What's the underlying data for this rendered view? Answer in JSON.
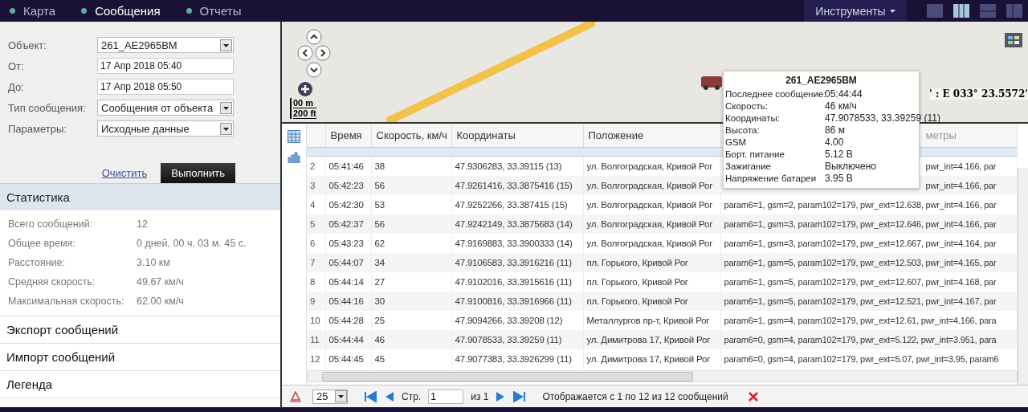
{
  "nav": {
    "tabs": [
      {
        "label": "Карта",
        "selected": false
      },
      {
        "label": "Сообщения",
        "selected": true
      },
      {
        "label": "Отчеты",
        "selected": false
      }
    ],
    "tools_menu": "Инструменты",
    "layouts": [
      {
        "selected": false
      },
      {
        "selected": true
      },
      {
        "selected": false
      },
      {
        "selected": false
      }
    ]
  },
  "form": {
    "fields": [
      {
        "label": "Объект:",
        "kind": "select",
        "value": "261_AE2965BM"
      },
      {
        "label": "От:",
        "kind": "input",
        "value": "17 Апр 2018 05:40"
      },
      {
        "label": "До:",
        "kind": "input",
        "value": "17 Апр 2018 05:50"
      },
      {
        "label": "Тип сообщения:",
        "kind": "select",
        "value": "Сообщения от объекта"
      },
      {
        "label": "Параметры:",
        "kind": "select",
        "value": "Исходные данные"
      }
    ],
    "clear_link": "Очистить",
    "run_button": "Выполнить"
  },
  "statistics": {
    "title": "Статистика",
    "rows": [
      {
        "label": "Всего сообщений:",
        "value": "12"
      },
      {
        "label": "Общее время:",
        "value": "0 дней, 00 ч. 03 м. 45 с."
      },
      {
        "label": "Расстояние:",
        "value": "3.10 км"
      },
      {
        "label": "Средняя скорость:",
        "value": "49.67 км/ч"
      },
      {
        "label": "Максимальная скорость:",
        "value": "62.00 км/ч"
      }
    ]
  },
  "sections": [
    "Экспорт сообщений",
    "Импорт сообщений",
    "Легенда"
  ],
  "map": {
    "scale": [
      "00 m",
      "200 ft"
    ],
    "coords_readout": "' : E 033° 23.5572'",
    "tooltip": {
      "title": "261_AE2965BM",
      "rows": [
        {
          "label": "Последнее сообщение:",
          "value": "05:44:44"
        },
        {
          "label": "Скорость:",
          "value": "46 км/ч"
        },
        {
          "label": "Координаты:",
          "value": "47.9078533, 33.39259 (11)"
        },
        {
          "label": "Высота:",
          "value": "86 м"
        },
        {
          "label": "GSM",
          "value": "4.00"
        },
        {
          "label": "Борт. питание",
          "value": "5.12 В"
        },
        {
          "label": "Зажигание",
          "value": "Выключено"
        },
        {
          "label": "Напряжение батареи",
          "value": "3.95 В"
        }
      ]
    }
  },
  "table": {
    "columns": [
      "Время",
      "Скорость, км/ч",
      "Координаты",
      "Положение",
      "метры"
    ],
    "rows": [
      {
        "n": "2",
        "time": "05:41:46",
        "speed": "38",
        "coords": "47.9306283, 33.39115 (13)",
        "place": "ул. Волгоградская, Кривой Рог",
        "params": "pwr_int=4.166, par",
        "covered": true
      },
      {
        "n": "3",
        "time": "05:42:23",
        "speed": "56",
        "coords": "47.9261416, 33.3875416 (15)",
        "place": "ул. Волгоградская, Кривой Рог",
        "params": "pwr_int=4.166, par",
        "covered": true
      },
      {
        "n": "4",
        "time": "05:42:30",
        "speed": "53",
        "coords": "47.9252266, 33.387415 (15)",
        "place": "ул. Волгоградская, Кривой Рог",
        "params": "param6=1, gsm=2, param102=179, pwr_ext=12.638, pwr_int=4.166, par",
        "covered": false
      },
      {
        "n": "5",
        "time": "05:42:37",
        "speed": "56",
        "coords": "47.9242149, 33.3875683 (14)",
        "place": "ул. Волгоградская, Кривой Рог",
        "params": "param6=1, gsm=3, param102=179, pwr_ext=12.646, pwr_int=4.166, par",
        "covered": false
      },
      {
        "n": "6",
        "time": "05:43:23",
        "speed": "62",
        "coords": "47.9169883, 33.3900333 (14)",
        "place": "ул. Волгоградская, Кривой Рог",
        "params": "param6=1, gsm=3, param102=179, pwr_ext=12.667, pwr_int=4.164, par",
        "covered": false
      },
      {
        "n": "7",
        "time": "05:44:07",
        "speed": "34",
        "coords": "47.9106583, 33.3916216 (11)",
        "place": "пл. Горького, Кривой Рог",
        "params": "param6=1, gsm=5, param102=179, pwr_ext=12.503, pwr_int=4.165, par",
        "covered": false
      },
      {
        "n": "8",
        "time": "05:44:14",
        "speed": "27",
        "coords": "47.9102016, 33.3915616 (11)",
        "place": "пл. Горького, Кривой Рог",
        "params": "param6=1, gsm=5, param102=179, pwr_ext=12.607, pwr_int=4.168, par",
        "covered": false
      },
      {
        "n": "9",
        "time": "05:44:16",
        "speed": "30",
        "coords": "47.9100816, 33.3916966 (11)",
        "place": "пл. Горького, Кривой Рог",
        "params": "param6=1, gsm=5, param102=179, pwr_ext=12.521, pwr_int=4.167, par",
        "covered": false
      },
      {
        "n": "10",
        "time": "05:44:28",
        "speed": "25",
        "coords": "47.9094266, 33.39208 (12)",
        "place": "Металлургов пр-т, Кривой Рог",
        "params": "param6=1, gsm=4, param102=179, pwr_ext=12.61, pwr_int=4.166, para",
        "covered": false
      },
      {
        "n": "11",
        "time": "05:44:44",
        "speed": "46",
        "coords": "47.9078533, 33.39259 (11)",
        "place": "ул. Димитрова 17, Кривой Рог",
        "params": "param6=0, gsm=4, param102=179, pwr_ext=5.122, pwr_int=3.951, para",
        "covered": false
      },
      {
        "n": "12",
        "time": "05:44:45",
        "speed": "45",
        "coords": "47.9077383, 33.3926299 (11)",
        "place": "ул. Димитрова 17, Кривой Рог",
        "params": "param6=0, gsm=4, param102=179, pwr_ext=5.07, pwr_int=3.95, param6",
        "covered": false
      }
    ]
  },
  "pager": {
    "page_size": "25",
    "page_label": "Стр.",
    "page": "1",
    "of": "из 1",
    "status": "Отображается с 1 по 12 из 12 сообщений"
  }
}
